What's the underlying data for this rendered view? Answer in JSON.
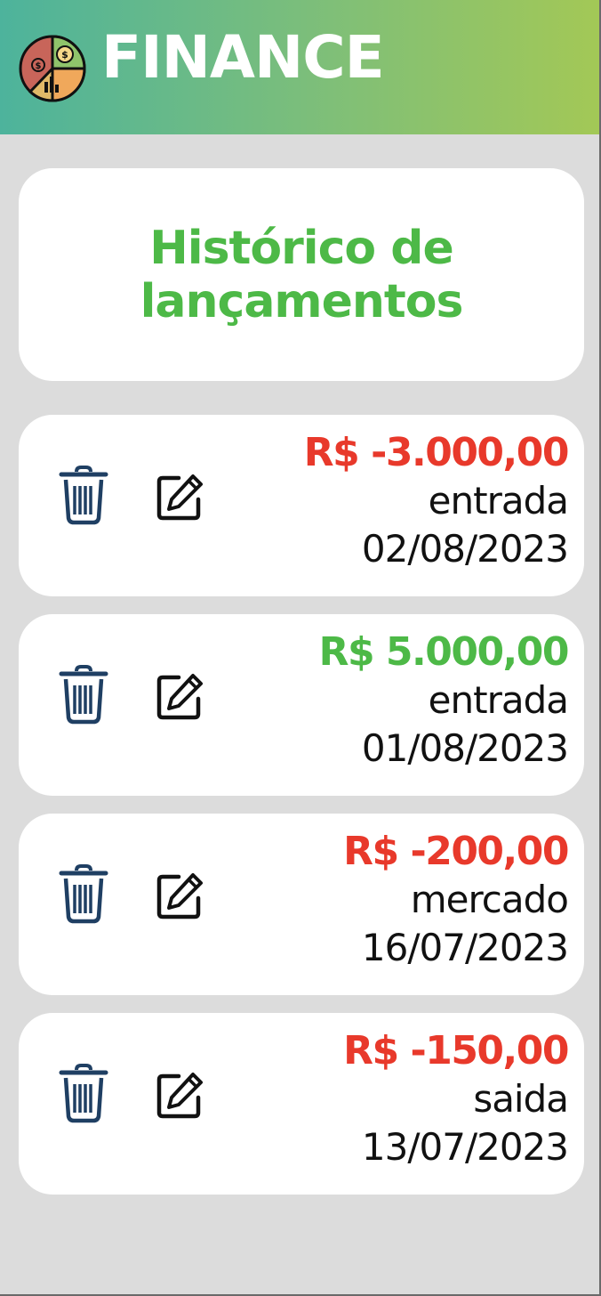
{
  "header": {
    "app_title": "FINANCE",
    "logo_icon": "finance-pie-chart-icon",
    "gradient_start": "#4db39c",
    "gradient_end": "#a3c856"
  },
  "main": {
    "page_title_line1": "Histórico de",
    "page_title_line2": "lançamentos",
    "entries": [
      {
        "amount": "R$ -3.000,00",
        "category": "entrada",
        "date": "02/08/2023",
        "amount_color": "#e8392b",
        "delete_icon": "trash-icon",
        "edit_icon": "edit-icon"
      },
      {
        "amount": "R$ 5.000,00",
        "category": "entrada",
        "date": "01/08/2023",
        "amount_color": "#4db947",
        "delete_icon": "trash-icon",
        "edit_icon": "edit-icon"
      },
      {
        "amount": "R$ -200,00",
        "category": "mercado",
        "date": "16/07/2023",
        "amount_color": "#e8392b",
        "delete_icon": "trash-icon",
        "edit_icon": "edit-icon"
      },
      {
        "amount": "R$ -150,00",
        "category": "saida",
        "date": "13/07/2023",
        "amount_color": "#e8392b",
        "delete_icon": "trash-icon",
        "edit_icon": "edit-icon"
      }
    ]
  },
  "colors": {
    "accent_green": "#4db947",
    "negative_red": "#e8392b",
    "icon_navy": "#1f3f63",
    "background": "#dcdcdc"
  }
}
